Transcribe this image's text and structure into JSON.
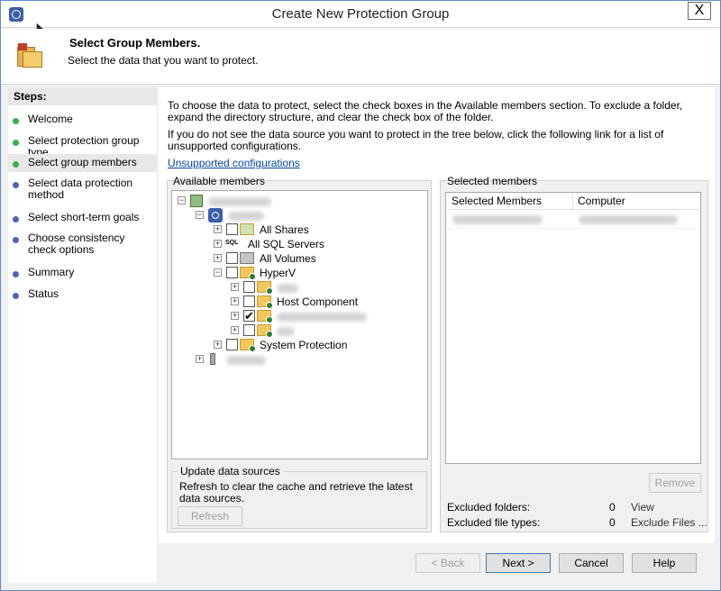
{
  "window": {
    "title": "Create New Protection Group",
    "close_glyph": "X"
  },
  "header": {
    "title": "Select Group Members.",
    "subtitle": "Select the data that you want to protect."
  },
  "steps": {
    "heading": "Steps:",
    "items": [
      {
        "label": "Welcome",
        "status": "done"
      },
      {
        "label": "Select protection group type",
        "status": "done"
      },
      {
        "label": "Select group members",
        "status": "current"
      },
      {
        "label": "Select data protection method",
        "status": "pending"
      },
      {
        "label": "Select short-term goals",
        "status": "pending"
      },
      {
        "label": "Choose consistency check options",
        "status": "pending"
      },
      {
        "label": "Summary",
        "status": "pending"
      },
      {
        "label": "Status",
        "status": "pending"
      }
    ]
  },
  "main": {
    "intro1": "To choose the data to protect, select the check boxes in the Available members section. To exclude a folder, expand the directory structure, and clear the check box of the folder.",
    "intro2": "If you do not see the data source you want to protect in the tree below, click the following link for a list of unsupported configurations.",
    "link": "Unsupported configurations",
    "available_label": "Available members",
    "selected_label": "Selected members",
    "tree": {
      "all_shares": "All Shares",
      "all_sql": "All SQL Servers",
      "all_volumes": "All Volumes",
      "hyperv": "HyperV",
      "host_component": "Host Component",
      "system_protection": "System Protection",
      "sql_badge": "SQL",
      "checked_glyph": "✔",
      "expander_plus": "+",
      "expander_minus": "−"
    },
    "selected_columns": [
      "Selected Members",
      "Computer"
    ],
    "update": {
      "title": "Update data sources",
      "text": "Refresh to clear the cache and retrieve the latest data sources.",
      "refresh_button": "Refresh"
    },
    "remove_button": "Remove",
    "excluded_folders_label": "Excluded folders:",
    "excluded_folders_count": "0",
    "excluded_folders_link": "View",
    "excluded_types_label": "Excluded file types:",
    "excluded_types_count": "0",
    "excluded_types_link": "Exclude Files ..."
  },
  "footer": {
    "back": "< Back",
    "next": "Next >",
    "cancel": "Cancel",
    "help": "Help"
  }
}
